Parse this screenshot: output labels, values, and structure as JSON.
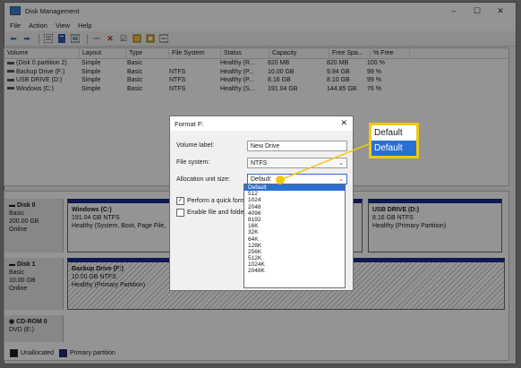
{
  "window": {
    "title": "Disk Management",
    "menu": [
      "File",
      "Action",
      "View",
      "Help"
    ],
    "controls": {
      "minimize": "–",
      "maximize": "☐",
      "close": "✕"
    }
  },
  "volume_list": {
    "headers": [
      "Volume",
      "Layout",
      "Type",
      "File System",
      "Status",
      "Capacity",
      "Free Spa...",
      "% Free"
    ],
    "rows": [
      [
        "(Disk 0 partition 2)",
        "Simple",
        "Basic",
        "",
        "Healthy (R...",
        "820 MB",
        "820 MB",
        "100 %"
      ],
      [
        "Backup Drive (F:)",
        "Simple",
        "Basic",
        "NTFS",
        "Healthy (P...",
        "10.00 GB",
        "9.94 GB",
        "99 %"
      ],
      [
        "USB DRIVE (D:)",
        "Simple",
        "Basic",
        "NTFS",
        "Healthy (P...",
        "8.16 GB",
        "8.10 GB",
        "99 %"
      ],
      [
        "Windows (C:)",
        "Simple",
        "Basic",
        "NTFS",
        "Healthy (S...",
        "191.04 GB",
        "144.85 GB",
        "76 %"
      ]
    ]
  },
  "disks": [
    {
      "name": "Disk 0",
      "type": "Basic",
      "size": "200.00 GB",
      "state": "Online",
      "partitions": [
        {
          "name": "Windows (C:)",
          "size": "191.04 GB NTFS",
          "status": "Healthy (System, Boot, Page File,"
        },
        {
          "name": "USB DRIVE (D:)",
          "size": "8.16 GB NTFS",
          "status": "Healthy (Primary Partition)"
        }
      ]
    },
    {
      "name": "Disk 1",
      "type": "Basic",
      "size": "10.00 GB",
      "state": "Online",
      "partitions": [
        {
          "name": "Backup Drive (F:)",
          "size": "10.00 GB NTFS",
          "status": "Healthy (Primary Partition)"
        }
      ]
    },
    {
      "name": "CD-ROM 0",
      "type": "DVD (E:)",
      "size": "",
      "state": "",
      "partitions": []
    }
  ],
  "legend": {
    "unallocated": "Unallocated",
    "primary": "Primary partition",
    "unallocated_color": "#1a1a1a",
    "primary_color": "#1c2a8c"
  },
  "dialog": {
    "title": "Format F:",
    "volume_label_label": "Volume label:",
    "volume_label_value": "New Drive",
    "file_system_label": "File system:",
    "file_system_value": "NTFS",
    "allocation_label": "Allocation unit size:",
    "allocation_value": "Default",
    "quick_format_label": "Perform a quick format",
    "compression_label": "Enable file and folder c",
    "close": "✕"
  },
  "allocation_options": [
    "Default",
    "512",
    "1024",
    "2048",
    "4096",
    "8192",
    "16K",
    "32K",
    "64K",
    "128K",
    "256K",
    "512K",
    "1024K",
    "2048K"
  ],
  "callout": {
    "items": [
      "Default",
      "Default"
    ],
    "accent": "#f2c80f",
    "highlight": "#2b6fd3"
  }
}
